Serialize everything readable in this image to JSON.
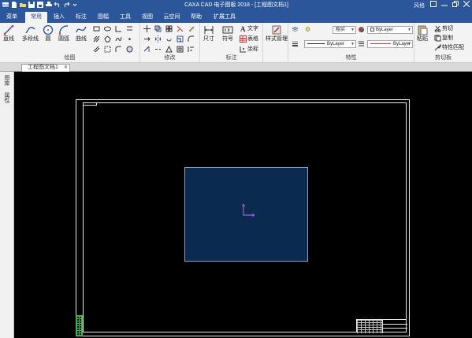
{
  "titlebar": {
    "title": "CAXA CAD 电子图板 2018 - [工程图文档1]",
    "user": "风格",
    "minimize_icon": "minimize-icon",
    "restore_icon": "restore-icon",
    "close_icon": "close-icon"
  },
  "menu_tabs": [
    "菜单",
    "常用",
    "插入",
    "标注",
    "图幅",
    "工具",
    "视图",
    "云空间",
    "帮助",
    "扩展工具"
  ],
  "active_tab": "常用",
  "ribbon": {
    "draw": {
      "label": "绘图",
      "buttons": [
        "直线",
        "多段线",
        "圆",
        "圆弧",
        "曲线"
      ]
    },
    "modify": {
      "label": "修改"
    },
    "annotate": {
      "label": "标注",
      "buttons": [
        "尺寸",
        "符号"
      ],
      "text_items": [
        "文字",
        "表格",
        "坐标"
      ]
    },
    "style": {
      "label": "样式管理"
    },
    "properties": {
      "label": "特性",
      "layer_value": "粗实",
      "color_value": "ByLayer",
      "linetype_value": "ByLayer",
      "lineweight_value": "ByLayer"
    },
    "clipboard": {
      "label": "剪切板",
      "paste_label": "粘贴",
      "items": [
        "剪切",
        "复制",
        "特性匹配"
      ]
    }
  },
  "document_tab": {
    "label": "工程图文档1"
  },
  "side_panel": {
    "labels": [
      "图库",
      "属性"
    ]
  }
}
